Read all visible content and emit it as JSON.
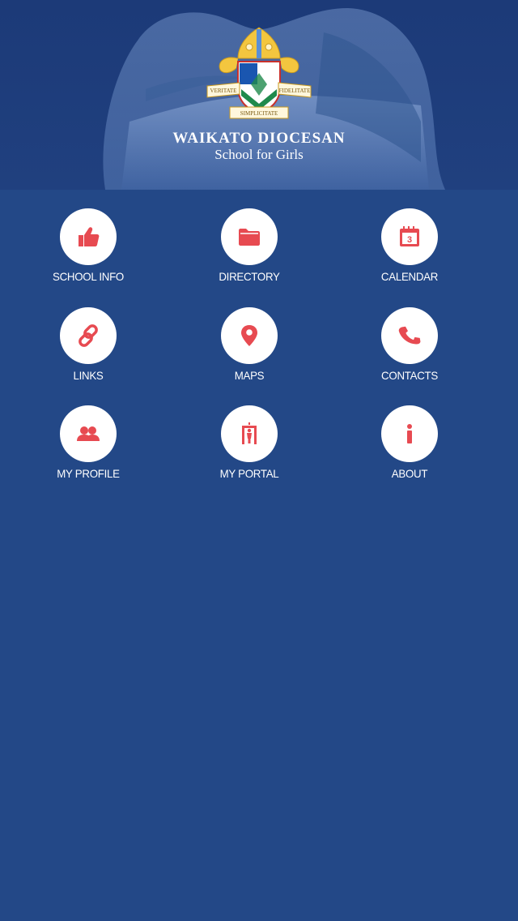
{
  "header": {
    "name_line1": "WAIKATO DIOCESAN",
    "name_line2": "School for Girls",
    "motto_left": "VERITATE",
    "motto_right": "FIDELITATE",
    "motto_bottom": "SIMPLICITATE"
  },
  "colors": {
    "background": "#234887",
    "icon": "#e74a51",
    "tile_circle": "#ffffff",
    "text": "#ffffff"
  },
  "menu": [
    {
      "label": "SCHOOL INFO",
      "icon": "thumbs-up-icon"
    },
    {
      "label": "DIRECTORY",
      "icon": "folder-icon"
    },
    {
      "label": "CALENDAR",
      "icon": "calendar-icon",
      "icon_text": "3"
    },
    {
      "label": "LINKS",
      "icon": "link-icon"
    },
    {
      "label": "MAPS",
      "icon": "map-pin-icon"
    },
    {
      "label": "CONTACTS",
      "icon": "phone-icon"
    },
    {
      "label": "MY PROFILE",
      "icon": "users-icon"
    },
    {
      "label": "MY PORTAL",
      "icon": "portal-icon"
    },
    {
      "label": "ABOUT",
      "icon": "info-icon"
    }
  ]
}
